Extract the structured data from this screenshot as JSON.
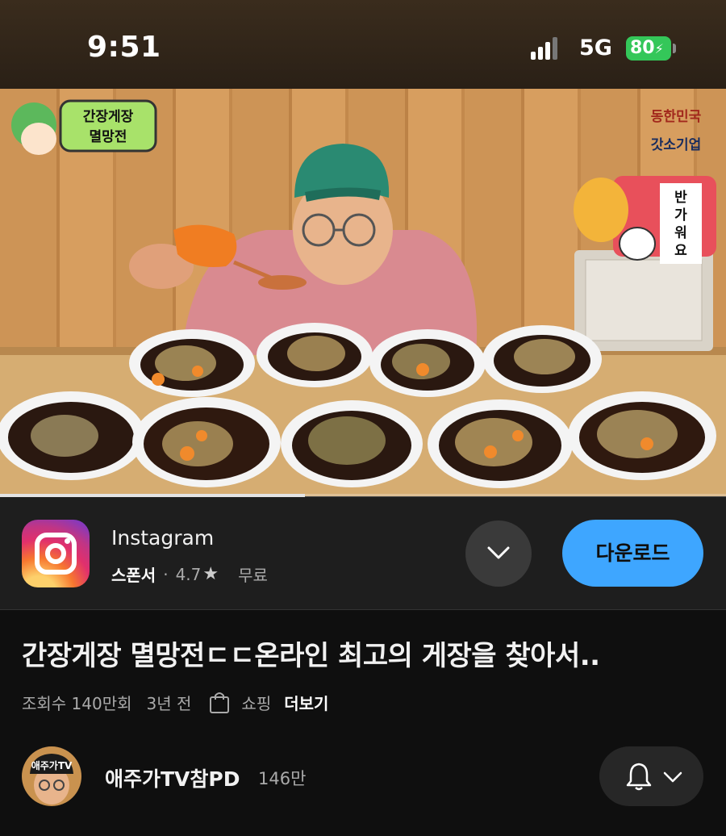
{
  "status_bar": {
    "time": "9:51",
    "network": "5G",
    "battery": "80",
    "battery_color": "#34c759"
  },
  "video": {
    "overlay_left_text": [
      "간장게장",
      "멸망전"
    ],
    "overlay_right_text": [
      "동한민국",
      "갓소기업"
    ],
    "overlay_sign": "반가워요",
    "progress_fraction": 0.42
  },
  "ad": {
    "app_name": "Instagram",
    "sponsor_label": "스폰서",
    "separator": "·",
    "rating": "4.7",
    "price": "무료",
    "download_label": "다운로드",
    "icon": "instagram-icon",
    "accent_color": "#3ea6ff"
  },
  "video_info": {
    "title": "간장게장 멸망전ㄷㄷ온라인 최고의 게장을 찾아서..",
    "views": "조회수 140만회",
    "age": "3년 전",
    "shopping_label": "쇼핑",
    "more_label": "더보기"
  },
  "channel": {
    "name": "애주가TV참PD",
    "subscribers": "146만",
    "avatar_text": "애주가TV"
  }
}
